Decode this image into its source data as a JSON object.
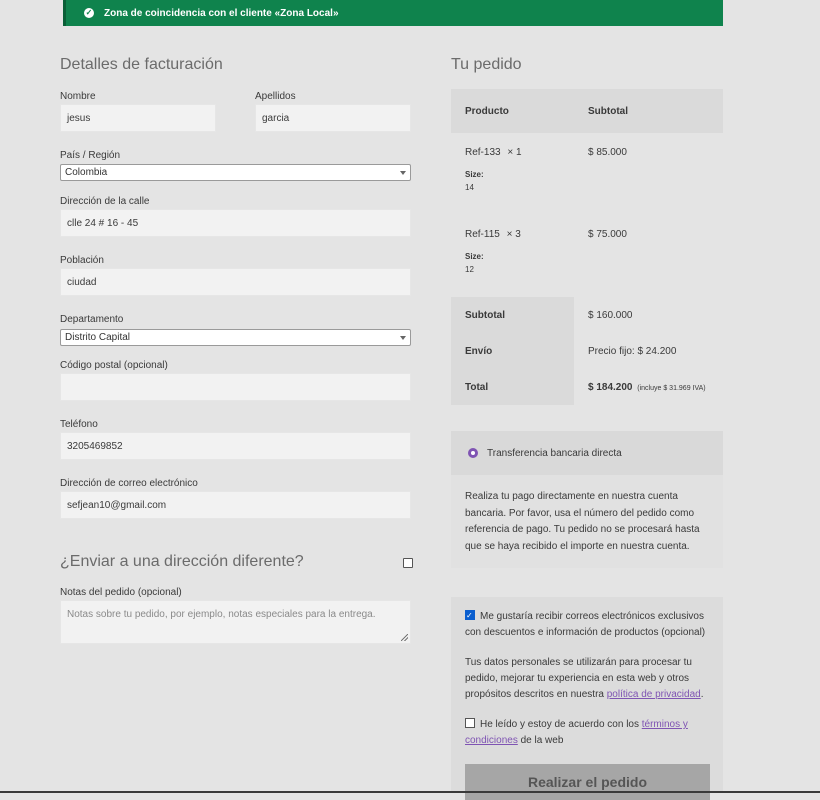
{
  "notice": {
    "text": "Zona de coincidencia con el cliente «Zona Local»"
  },
  "billing": {
    "title": "Detalles de facturación",
    "first_name": {
      "label": "Nombre",
      "value": "jesus"
    },
    "last_name": {
      "label": "Apellidos",
      "value": "garcia"
    },
    "country": {
      "label": "País / Región",
      "value": "Colombia"
    },
    "street": {
      "label": "Dirección de la calle",
      "value": "clle 24 # 16 - 45"
    },
    "city": {
      "label": "Población",
      "value": "ciudad"
    },
    "state": {
      "label": "Departamento",
      "value": "Distrito Capital"
    },
    "postcode": {
      "label": "Código postal (opcional)",
      "value": ""
    },
    "phone": {
      "label": "Teléfono",
      "value": "3205469852"
    },
    "email": {
      "label": "Dirección de correo electrónico",
      "value": "sefjean10@gmail.com"
    }
  },
  "shipping": {
    "title": "¿Enviar a una dirección diferente?"
  },
  "notes": {
    "label": "Notas del pedido (opcional)",
    "placeholder": "Notas sobre tu pedido, por ejemplo, notas especiales para la entrega."
  },
  "order": {
    "title": "Tu pedido",
    "col_product": "Producto",
    "col_subtotal": "Subtotal",
    "items": [
      {
        "name": "Ref-133",
        "qty": "× 1",
        "meta_key": "Size:",
        "meta_val": "14",
        "price": "$ 85.000"
      },
      {
        "name": "Ref-115",
        "qty": "× 3",
        "meta_key": "Size:",
        "meta_val": "12",
        "price": "$ 75.000"
      }
    ],
    "subtotal_label": "Subtotal",
    "subtotal_value": "$ 160.000",
    "shipping_label": "Envío",
    "shipping_value": "Precio fijo: $ 24.200",
    "total_label": "Total",
    "total_value": "$ 184.200",
    "total_tax": "(incluye $ 31.969 IVA)"
  },
  "payment": {
    "method": "Transferencia bancaria directa",
    "description": "Realiza tu pago directamente en nuestra cuenta bancaria. Por favor, usa el número del pedido como referencia de pago. Tu pedido no se procesará hasta que se haya recibido el importe en nuestra cuenta."
  },
  "terms": {
    "newsletter": "Me gustaría recibir correos electrónicos exclusivos con descuentos e información de productos (opcional)",
    "privacy_text": "Tus datos personales se utilizarán para procesar tu pedido, mejorar tu experiencia en esta web y otros propósitos descritos en nuestra",
    "privacy_link": "política de privacidad",
    "accept_text": "He leído y estoy de acuerdo con los",
    "terms_link": "términos y condiciones",
    "accept_suffix": "de la web",
    "place_order": "Realizar el pedido"
  },
  "colors": {
    "notice": "#0f834d",
    "accent": "#7f54b3"
  }
}
